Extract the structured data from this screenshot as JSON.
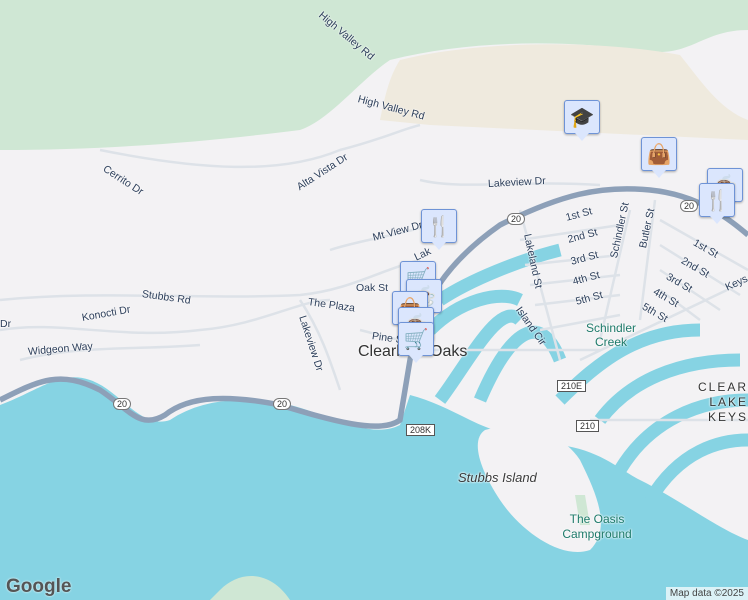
{
  "map": {
    "colors": {
      "land": "#f3f2f4",
      "water": "#86d3e3",
      "park": "#cfe7d4",
      "sand": "#efeade",
      "road": "#dde2e8",
      "highway": "#8da0b8",
      "pin": "#0b4a72"
    },
    "streets": {
      "high_valley_rd_1": "High Valley Rd",
      "high_valley_rd_2": "High Valley Rd",
      "cerrito": "Cerrito Dr",
      "alta_vista": "Alta Vista Dr",
      "lakeview_dr_n": "Lakeview Dr",
      "mt_view": "Mt View Dr",
      "lak": "Lak",
      "oak": "Oak St",
      "stubbs": "Stubbs Rd",
      "plaza": "The Plaza",
      "dr": "Dr",
      "konocti": "Konocti Dr",
      "widgeon": "Widgeon Way",
      "lakeview_dr_s": "Lakeview Dr",
      "pine": "Pine St",
      "lakeland": "Lakeland St",
      "island_cir": "Island Cir",
      "first_a": "1st St",
      "second_a": "2nd St",
      "third_a": "3rd St",
      "fourth_a": "4th St",
      "fifth_a": "5th St",
      "schindler": "Schindler St",
      "butler": "Butler St",
      "first_b": "1st St",
      "second_b": "2nd St",
      "third_b": "3rd St",
      "fourth_b": "4th St",
      "fifth_b": "5th St",
      "keys": "Keys"
    },
    "places": {
      "town": "Clearlake Oaks",
      "creek": "Schindler Creek",
      "keys": "CLEAR LAKE KEYS",
      "island": "Stubbs Island",
      "camp": "The Oasis Campground"
    },
    "shields": {
      "r20a": "20",
      "r20b": "20",
      "r20c": "20",
      "r210e": "210E",
      "r210": "210",
      "r208k": "208K"
    },
    "pins": [
      "school",
      "shopping-bag",
      "restaurant",
      "cafe",
      "restaurant",
      "grocery",
      "cafe",
      "shopping-bag",
      "cafe",
      "grocery"
    ],
    "logo": "Google",
    "attribution": "Map data ©2025"
  }
}
